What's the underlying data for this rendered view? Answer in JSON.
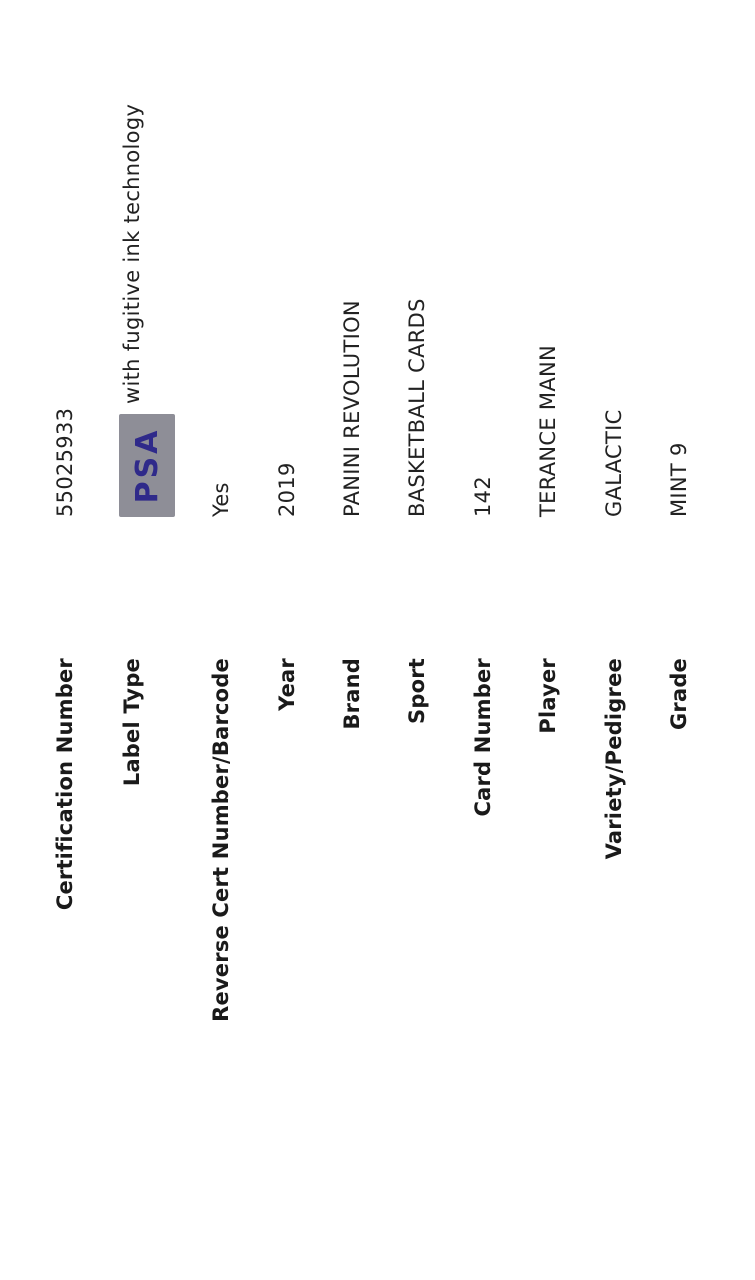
{
  "cert": {
    "rows": [
      {
        "label": "Certification Number",
        "value": "55025933"
      },
      {
        "label": "Label Type",
        "logo_text": "PSA",
        "value": "with fugitive ink technology"
      },
      {
        "label": "Reverse Cert Number/Barcode",
        "value": "Yes"
      },
      {
        "label": "Year",
        "value": "2019"
      },
      {
        "label": "Brand",
        "value": "PANINI REVOLUTION"
      },
      {
        "label": "Sport",
        "value": "BASKETBALL CARDS"
      },
      {
        "label": "Card Number",
        "value": "142"
      },
      {
        "label": "Player",
        "value": "TERANCE MANN"
      },
      {
        "label": "Variety/Pedigree",
        "value": "GALACTIC"
      },
      {
        "label": "Grade",
        "value": "MINT 9"
      }
    ]
  }
}
